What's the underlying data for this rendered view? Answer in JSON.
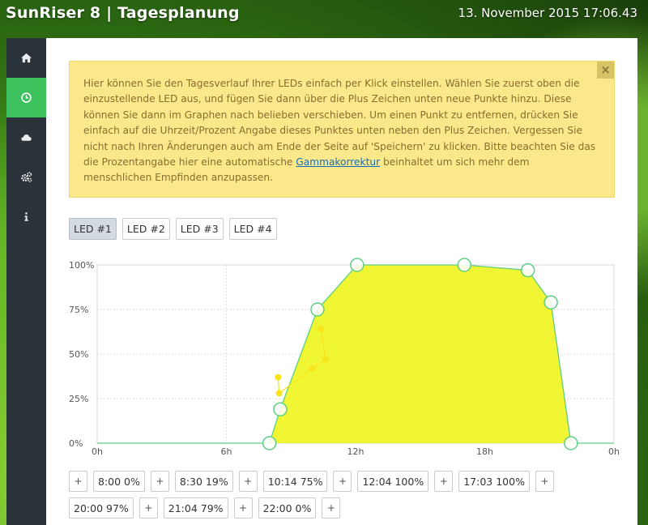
{
  "header": {
    "title": "SunRiser 8 | Tagesplanung",
    "datetime": "13. November 2015 17:06.43"
  },
  "sidebar": {
    "items": [
      {
        "icon": "home-icon",
        "active": false
      },
      {
        "icon": "clock-icon",
        "active": true
      },
      {
        "icon": "cloud-icon",
        "active": false
      },
      {
        "icon": "gears-icon",
        "active": false
      },
      {
        "icon": "info-icon",
        "active": false
      }
    ]
  },
  "info": {
    "text_before": "Hier können Sie den Tagesverlauf Ihrer LEDs einfach per Klick einstellen. Wählen Sie zuerst oben die einzustellende LED aus, und fügen Sie dann über die Plus Zeichen unten neue Punkte hinzu. Diese können Sie dann im Graphen nach belieben verschieben. Um einen Punkt zu entfernen, drücken Sie einfach auf die Uhrzeit/Prozent Angabe dieses Punktes unten neben den Plus Zeichen. Vergessen Sie nicht nach Ihren Änderungen auch am Ende der Seite auf 'Speichern' zu klicken. Bitte beachten Sie das die Prozentangabe hier eine automatische ",
    "link": "Gammakorrektur",
    "text_after": " beinhaltet um sich mehr dem menschlichen Empfinden anzupassen.",
    "close": "×"
  },
  "led_tabs": [
    {
      "label": "LED #1",
      "active": true
    },
    {
      "label": "LED #2",
      "active": false
    },
    {
      "label": "LED #3",
      "active": false
    },
    {
      "label": "LED #4",
      "active": false
    }
  ],
  "chart_data": {
    "type": "area",
    "x_ticks": [
      "0h",
      "6h",
      "12h",
      "18h",
      "0h"
    ],
    "y_ticks": [
      "100%",
      "75%",
      "50%",
      "25%",
      "0%"
    ],
    "xlim": [
      0,
      24
    ],
    "ylim": [
      0,
      100
    ],
    "grid": true,
    "colors": {
      "fill": "#eef41e",
      "line": "#5ccf84",
      "secondary": "#f6e51a"
    },
    "series": [
      {
        "points": [
          {
            "x": 0,
            "y": 0
          },
          {
            "x": 8.0,
            "y": 0
          },
          {
            "x": 8.5,
            "y": 19
          },
          {
            "x": 10.23,
            "y": 75
          },
          {
            "x": 12.07,
            "y": 100
          },
          {
            "x": 17.05,
            "y": 100
          },
          {
            "x": 20.0,
            "y": 97
          },
          {
            "x": 21.07,
            "y": 79
          },
          {
            "x": 22.0,
            "y": 0
          },
          {
            "x": 24,
            "y": 0
          }
        ]
      },
      {
        "points": [
          {
            "x": 8.4,
            "y": 37
          },
          {
            "x": 8.45,
            "y": 28
          },
          {
            "x": 10.0,
            "y": 42
          },
          {
            "x": 10.6,
            "y": 47
          },
          {
            "x": 10.4,
            "y": 64
          }
        ]
      }
    ]
  },
  "points": [
    "8:00 0%",
    "8:30 19%",
    "10:14 75%",
    "12:04 100%",
    "17:03 100%",
    "20:00 97%",
    "21:04 79%",
    "22:00 0%"
  ],
  "plus_label": "+"
}
